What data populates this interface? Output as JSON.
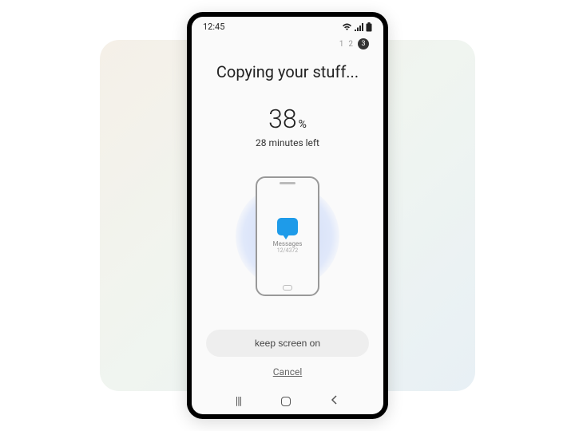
{
  "status": {
    "time": "12:45"
  },
  "steps": {
    "s1": "1",
    "s2": "2",
    "s3": "3"
  },
  "title": "Copying your stuff...",
  "progress": {
    "value": "38",
    "symbol": "%",
    "eta": "28 minutes left"
  },
  "currentItem": {
    "label": "Messages",
    "count": "12/4372"
  },
  "actions": {
    "keepScreen": "keep screen on",
    "cancel": "Cancel"
  },
  "nav": {
    "recent": "|||"
  }
}
